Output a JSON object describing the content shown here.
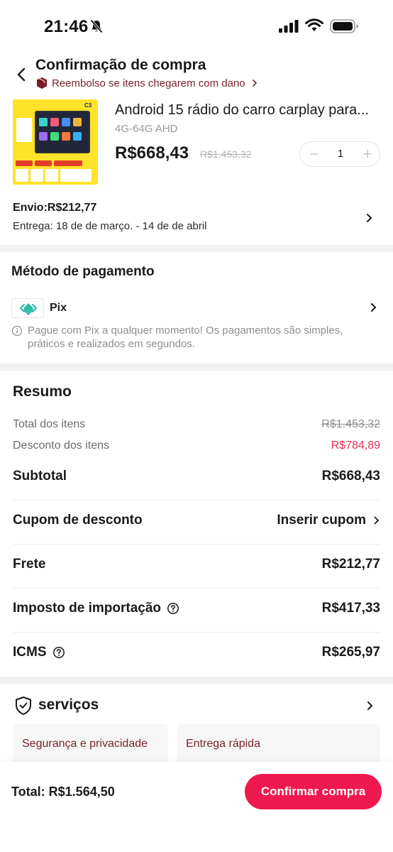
{
  "status_bar": {
    "time": "21:46"
  },
  "header": {
    "title": "Confirmação de compra",
    "refund_text": "Reembolso se itens chegarem com dano"
  },
  "product": {
    "title": "Android 15 rádio do carro carplay para...",
    "variant": "4G-64G AHD",
    "price": "R$668,43",
    "old_price": "R$1.453,32",
    "quantity": "1",
    "image_badge": "C3"
  },
  "shipping": {
    "cost": "Envio:R$212,77",
    "delivery": "Entrega: 18 de de março. - 14 de de abril"
  },
  "payment": {
    "section_title": "Método de pagamento",
    "method_name": "Pix",
    "note": "Pague com Pix a qualquer momento! Os pagamentos são simples, práticos e realizados em segundos."
  },
  "summary": {
    "title": "Resumo",
    "items_total_label": "Total dos itens",
    "items_total_value": "R$1.453,32",
    "discount_label": "Desconto dos itens",
    "discount_value": "R$784,89",
    "subtotal_label": "Subtotal",
    "subtotal_value": "R$668,43",
    "coupon_label": "Cupom de desconto",
    "coupon_action": "Inserir cupom",
    "shipping_label": "Frete",
    "shipping_value": "R$212,77",
    "import_tax_label": "Imposto de importação",
    "import_tax_value": "R$417,33",
    "icms_label": "ICMS",
    "icms_value": "R$265,97"
  },
  "services": {
    "title": "serviços",
    "cards": [
      "Segurança e privacidade",
      "Entrega rápida"
    ]
  },
  "footer": {
    "total": "Total:  R$1.564,50",
    "confirm_label": "Confirmar compra"
  },
  "colors": {
    "accent": "#f0194f",
    "discount": "#e8304f",
    "brand_dark": "#7a1f2b",
    "pix": "#32bcad"
  }
}
